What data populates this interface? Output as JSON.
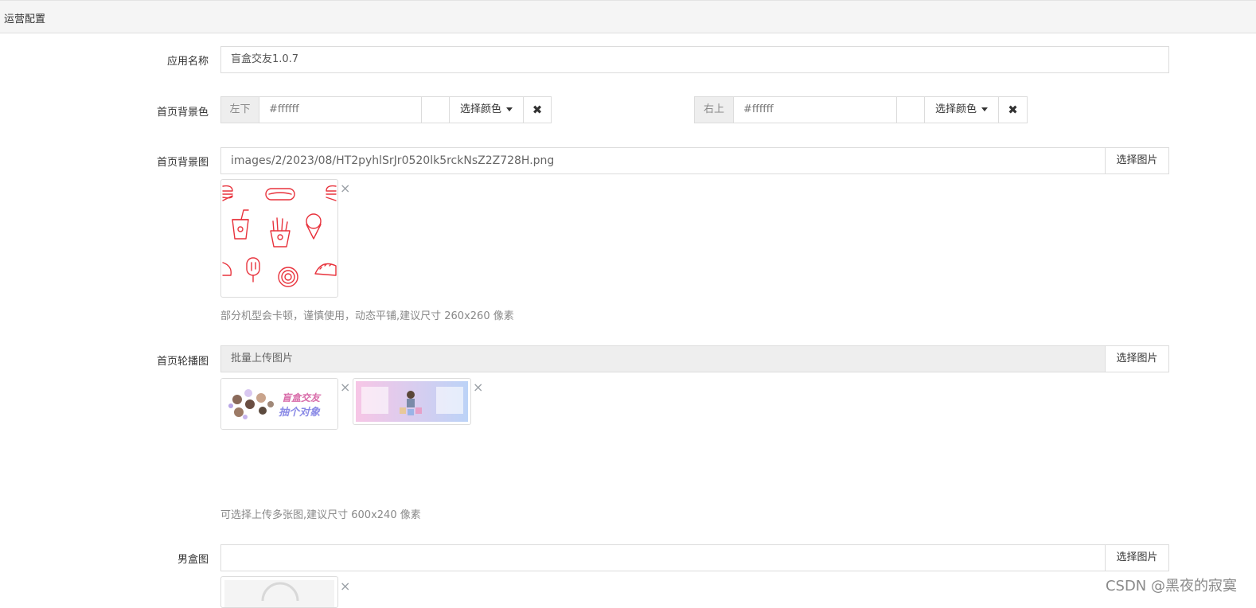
{
  "header": {
    "title": "运营配置"
  },
  "form": {
    "app_name": {
      "label": "应用名称",
      "value": "盲盒交友1.0.7"
    },
    "home_bg_color": {
      "label": "首页背景色",
      "left": {
        "addon": "左下",
        "value": "#ffffff",
        "pick_label": "选择颜色",
        "clear_icon": "close-icon"
      },
      "right": {
        "addon": "右上",
        "value": "#ffffff",
        "pick_label": "选择颜色",
        "clear_icon": "close-icon"
      }
    },
    "home_bg_image": {
      "label": "首页背景图",
      "value": "images/2/2023/08/HT2pyhlSrJr0520lk5rckNsZ2Z728H.png",
      "button": "选择图片",
      "help": "部分机型会卡顿，谨慎使用，动态平铺,建议尺寸 260x260 像素",
      "thumb_icon": "food-pattern-thumbnail"
    },
    "home_carousel": {
      "label": "首页轮播图",
      "placeholder": "批量上传图片",
      "button": "选择图片",
      "help": "可选择上传多张图,建议尺寸 600x240 像素",
      "thumbs": [
        {
          "text_line1": "盲盒交友",
          "text_line2": "抽个对象"
        },
        {
          "text": ""
        }
      ]
    },
    "male_box_image": {
      "label": "男盒图",
      "value": "",
      "button": "选择图片"
    }
  },
  "watermark": "CSDN @黑夜的寂寞",
  "colors": {
    "food_red": "#e8323c",
    "banner_pink": "#f7c6e6",
    "banner_blue": "#bcd3f7"
  }
}
